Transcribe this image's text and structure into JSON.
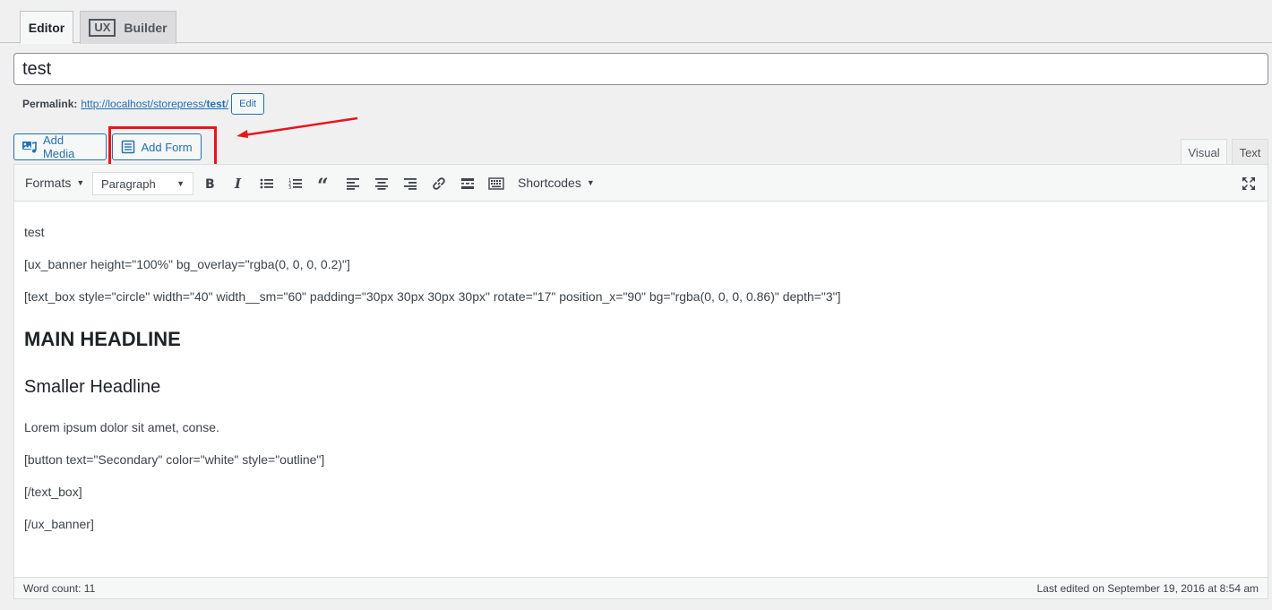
{
  "top_tabs": {
    "editor_label": "Editor",
    "ux_badge": "UX",
    "builder_label": "Builder"
  },
  "title": {
    "value": "test"
  },
  "permalink": {
    "label": "Permalink:",
    "url_base": "http://localhost/storepress/",
    "url_slug": "test",
    "url_trailing": "/",
    "edit_label": "Edit"
  },
  "media_buttons": {
    "add_media_label": "Add Media",
    "add_form_label": "Add Form"
  },
  "annotation": {
    "highlight_color": "#e8161d"
  },
  "editor_tabs": {
    "visual_label": "Visual",
    "text_label": "Text"
  },
  "toolbar": {
    "formats_label": "Formats",
    "paragraph_label": "Paragraph",
    "shortcodes_label": "Shortcodes",
    "icons": [
      "bold-icon",
      "italic-icon",
      "bullet-list-icon",
      "numbered-list-icon",
      "blockquote-icon",
      "align-left-icon",
      "align-center-icon",
      "align-right-icon",
      "link-icon",
      "read-more-icon",
      "toolbar-toggle-icon"
    ],
    "fullscreen_icon": "fullscreen-icon"
  },
  "content": {
    "p1": "test",
    "p2": "[ux_banner height=\"100%\" bg_overlay=\"rgba(0, 0, 0, 0.2)\"]",
    "p3": "[text_box style=\"circle\" width=\"40\" width__sm=\"60\" padding=\"30px 30px 30px 30px\" rotate=\"17\" position_x=\"90\" bg=\"rgba(0, 0, 0, 0.86)\" depth=\"3\"]",
    "h1": "MAIN HEADLINE",
    "h2": "Smaller Headline",
    "p4": "Lorem ipsum dolor sit amet, conse.",
    "p5": "[button text=\"Secondary\" color=\"white\" style=\"outline\"]",
    "p6": "[/text_box]",
    "p7": "[/ux_banner]"
  },
  "status": {
    "word_count": "Word count: 11",
    "last_edited": "Last edited on September 19, 2016 at 8:54 am"
  }
}
